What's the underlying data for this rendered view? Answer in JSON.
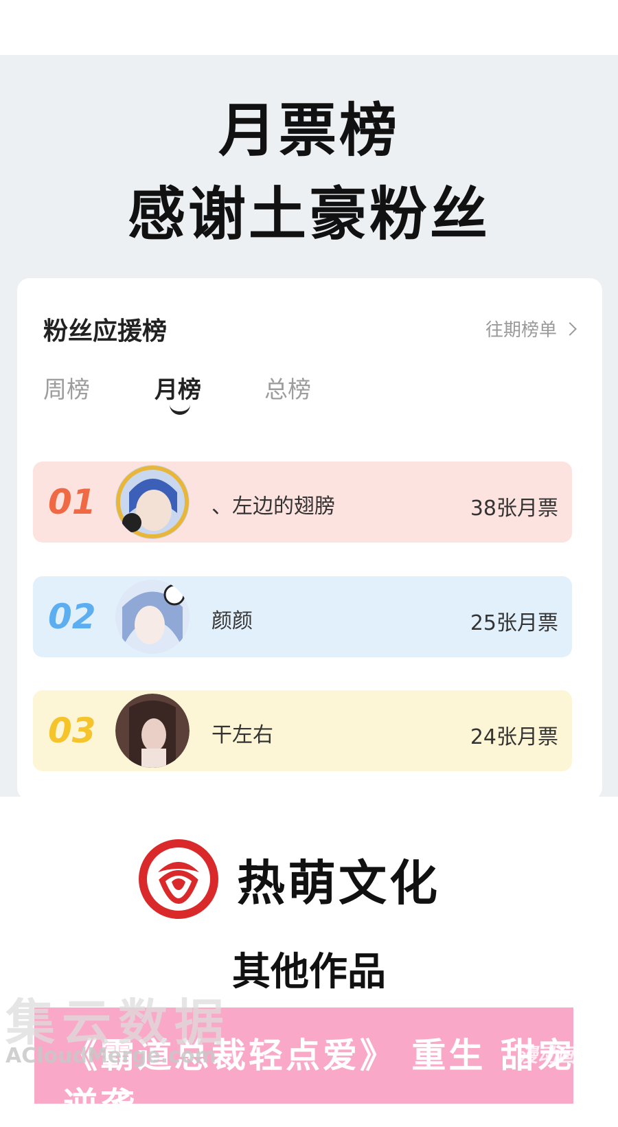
{
  "banner": {
    "title_line1": "月票榜",
    "title_line2": "感谢土豪粉丝"
  },
  "card": {
    "title": "粉丝应援榜",
    "history_link": "往期榜单",
    "tabs": [
      {
        "label": "周榜",
        "active": false
      },
      {
        "label": "月榜",
        "active": true
      },
      {
        "label": "总榜",
        "active": false
      }
    ],
    "ranks": [
      {
        "num": "01",
        "name": "、左边的翅膀",
        "tickets": "38张月票"
      },
      {
        "num": "02",
        "name": "颜颜",
        "tickets": "25张月票"
      },
      {
        "num": "03",
        "name": "干左右",
        "tickets": "24张月票"
      }
    ]
  },
  "brand": {
    "name": "热萌文化",
    "logo_color": "#d9292a"
  },
  "other_works": "其他作品",
  "promo": {
    "text": "《霸道总裁轻点爱》 重生 甜宠 逆袭"
  },
  "watermark": {
    "main": "集云数据",
    "sub": "ACloudMerge.com",
    "right": "漫动画"
  },
  "colors": {
    "rank1": "#ef6a44",
    "rank2": "#5caef0",
    "rank3": "#f4c42a",
    "promo_bg": "#f9a8c7"
  }
}
